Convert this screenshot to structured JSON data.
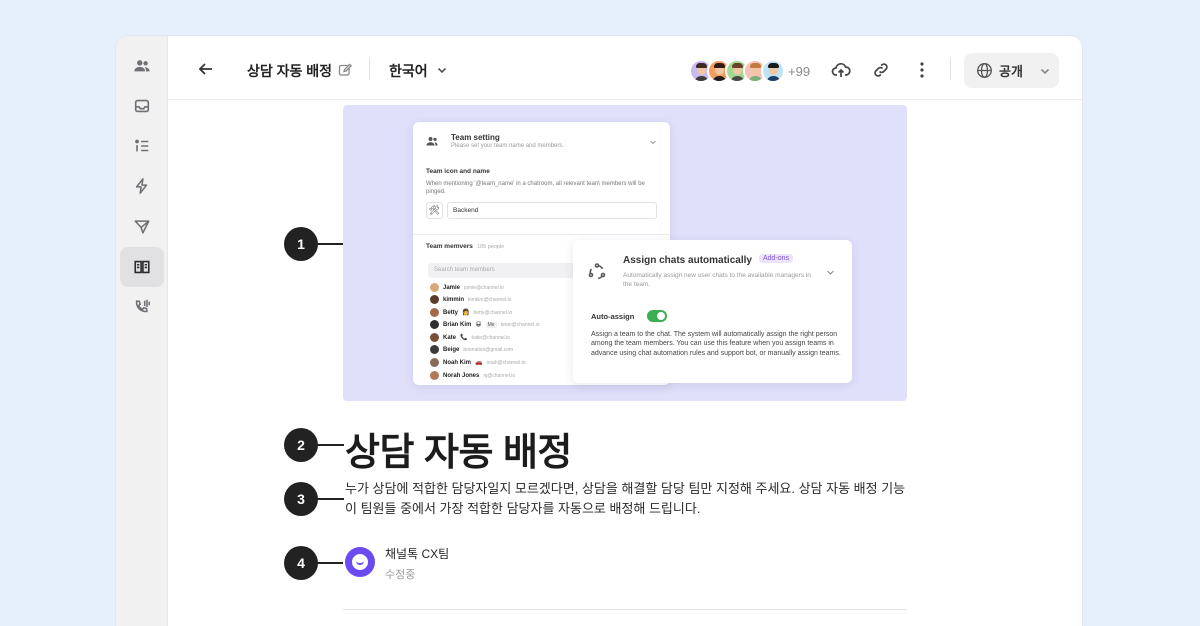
{
  "header": {
    "title": "상담 자동 배정",
    "language": "한국어",
    "collaborators_more": "+99",
    "visibility": "공개"
  },
  "sidebar": {
    "items": [
      {
        "name": "team",
        "icon": "people-icon"
      },
      {
        "name": "inbox",
        "icon": "inbox-icon"
      },
      {
        "name": "list",
        "icon": "list-icon"
      },
      {
        "name": "automation",
        "icon": "lightning-icon"
      },
      {
        "name": "send",
        "icon": "send-icon"
      },
      {
        "name": "docs",
        "icon": "book-icon",
        "active": true
      },
      {
        "name": "call",
        "icon": "phone-icon"
      }
    ]
  },
  "hero": {
    "team_setting": {
      "title": "Team setting",
      "subtitle": "Please set your team name and members.",
      "icon_heading": "Team icon and name",
      "icon_desc": "When mentioning '@team_name' in a chatroom, all relevant team members will be pinged.",
      "team_name": "Backend",
      "members_heading": "Team memvers",
      "members_count": "105 people",
      "search_placeholder": "Search team members",
      "members": [
        {
          "name": "Jamie",
          "email": "jamie@channel.io"
        },
        {
          "name": "kimmin",
          "email": "kimkim@channel.io"
        },
        {
          "name": "Betty",
          "email": "betty@channel.io",
          "emoji": "👩"
        },
        {
          "name": "Brian Kim",
          "email": "brian@channel.io",
          "emoji": "😀",
          "tag": "Me"
        },
        {
          "name": "Kate",
          "email": "katie@channel.io",
          "emoji": "📞"
        },
        {
          "name": "Beige",
          "email": "boonation@gmail.com"
        },
        {
          "name": "Noah Kim",
          "email": "noah@channel.io",
          "emoji": "🚗"
        },
        {
          "name": "Norah Jones",
          "email": "nj@channel.io"
        }
      ]
    },
    "assign": {
      "title": "Assign chats automatically",
      "badge": "Add-ons",
      "subtitle": "Automatically assign new user chats to the available managers in the team.",
      "toggle_label": "Auto-assign",
      "toggle_on": true,
      "description": "Assign a team to the chat. The system will automatically assign the right person among the team members. You can use this feature when you assign teams in advance using chat automation rules and support bot, or manually assign teams."
    }
  },
  "markers": [
    "1",
    "2",
    "3",
    "4"
  ],
  "article": {
    "heading": "상담 자동 배정",
    "description": "누가 상담에 적합한 담당자일지 모르겠다면, 상담을 해결할 담당 팀만 지정해 주세요. 상담 자동 배정 기능이 팀원들 중에서 가장 적합한 담당자를 자동으로 배정해 드립니다.",
    "author_name": "채널톡 CX팀",
    "author_status": "수정중"
  },
  "colors": {
    "page_bg": "#e6f0fb",
    "hero_bg": "#e0e0fb",
    "brand": "#6b4bf0",
    "toggle_on": "#3aae51",
    "badge": "#7b55d6"
  }
}
